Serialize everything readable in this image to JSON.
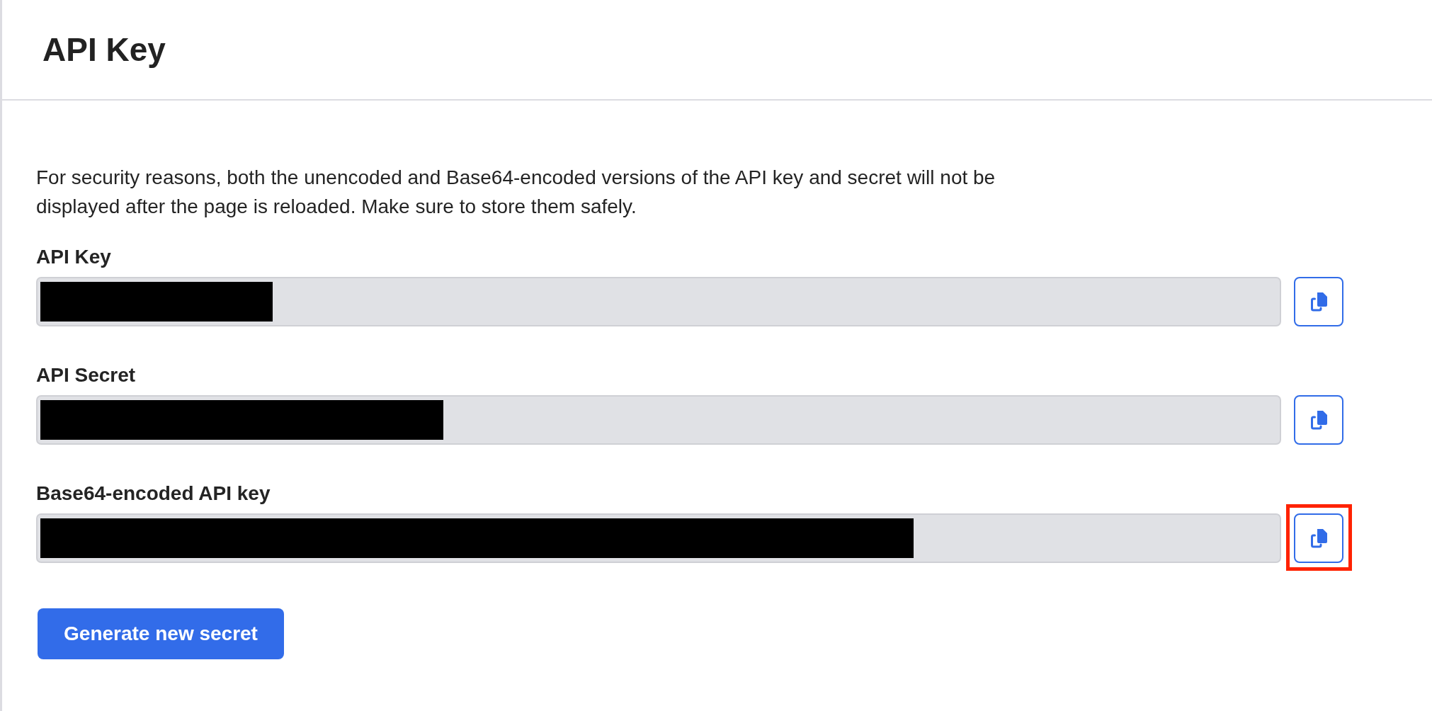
{
  "header": {
    "title": "API Key"
  },
  "notice": "For security reasons, both the unencoded and Base64-encoded versions of the API key and secret will not be displayed after the page is reloaded. Make sure to store them safely.",
  "fields": [
    {
      "label": "API Key",
      "redacted": true,
      "highlighted": false
    },
    {
      "label": "API Secret",
      "redacted": true,
      "highlighted": false
    },
    {
      "label": "Base64-encoded API key",
      "redacted": true,
      "highlighted": true
    }
  ],
  "generate_button": {
    "label": "Generate new secret"
  }
}
